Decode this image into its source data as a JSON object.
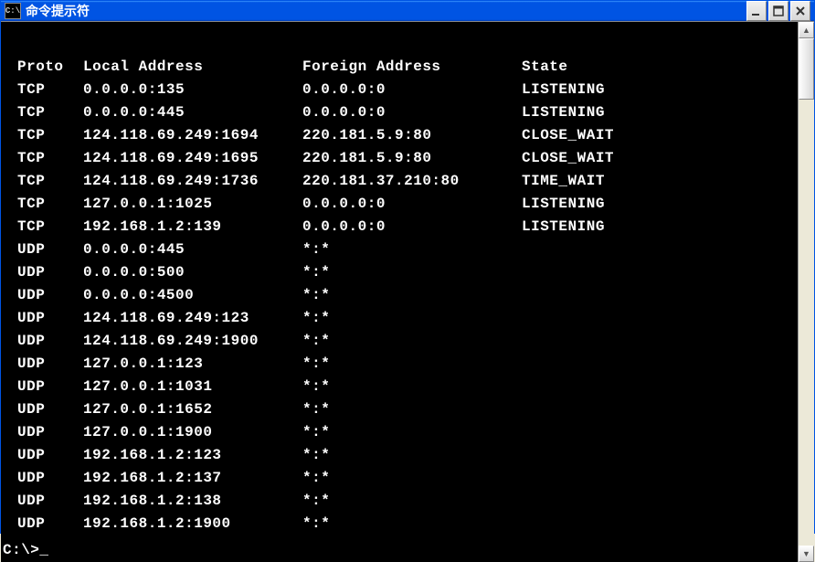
{
  "window": {
    "title": "命令提示符",
    "icon_label": "C:\\"
  },
  "header": {
    "proto": "Proto",
    "local": "Local Address",
    "foreign": "Foreign Address",
    "state": "State"
  },
  "rows": [
    {
      "proto": "TCP",
      "local": "0.0.0.0:135",
      "foreign": "0.0.0.0:0",
      "state": "LISTENING"
    },
    {
      "proto": "TCP",
      "local": "0.0.0.0:445",
      "foreign": "0.0.0.0:0",
      "state": "LISTENING"
    },
    {
      "proto": "TCP",
      "local": "124.118.69.249:1694",
      "foreign": "220.181.5.9:80",
      "state": "CLOSE_WAIT"
    },
    {
      "proto": "TCP",
      "local": "124.118.69.249:1695",
      "foreign": "220.181.5.9:80",
      "state": "CLOSE_WAIT"
    },
    {
      "proto": "TCP",
      "local": "124.118.69.249:1736",
      "foreign": "220.181.37.210:80",
      "state": "TIME_WAIT"
    },
    {
      "proto": "TCP",
      "local": "127.0.0.1:1025",
      "foreign": "0.0.0.0:0",
      "state": "LISTENING"
    },
    {
      "proto": "TCP",
      "local": "192.168.1.2:139",
      "foreign": "0.0.0.0:0",
      "state": "LISTENING"
    },
    {
      "proto": "UDP",
      "local": "0.0.0.0:445",
      "foreign": "*:*",
      "state": ""
    },
    {
      "proto": "UDP",
      "local": "0.0.0.0:500",
      "foreign": "*:*",
      "state": ""
    },
    {
      "proto": "UDP",
      "local": "0.0.0.0:4500",
      "foreign": "*:*",
      "state": ""
    },
    {
      "proto": "UDP",
      "local": "124.118.69.249:123",
      "foreign": "*:*",
      "state": ""
    },
    {
      "proto": "UDP",
      "local": "124.118.69.249:1900",
      "foreign": "*:*",
      "state": ""
    },
    {
      "proto": "UDP",
      "local": "127.0.0.1:123",
      "foreign": "*:*",
      "state": ""
    },
    {
      "proto": "UDP",
      "local": "127.0.0.1:1031",
      "foreign": "*:*",
      "state": ""
    },
    {
      "proto": "UDP",
      "local": "127.0.0.1:1652",
      "foreign": "*:*",
      "state": ""
    },
    {
      "proto": "UDP",
      "local": "127.0.0.1:1900",
      "foreign": "*:*",
      "state": ""
    },
    {
      "proto": "UDP",
      "local": "192.168.1.2:123",
      "foreign": "*:*",
      "state": ""
    },
    {
      "proto": "UDP",
      "local": "192.168.1.2:137",
      "foreign": "*:*",
      "state": ""
    },
    {
      "proto": "UDP",
      "local": "192.168.1.2:138",
      "foreign": "*:*",
      "state": ""
    },
    {
      "proto": "UDP",
      "local": "192.168.1.2:1900",
      "foreign": "*:*",
      "state": ""
    }
  ],
  "prompt": "C:\\>_"
}
